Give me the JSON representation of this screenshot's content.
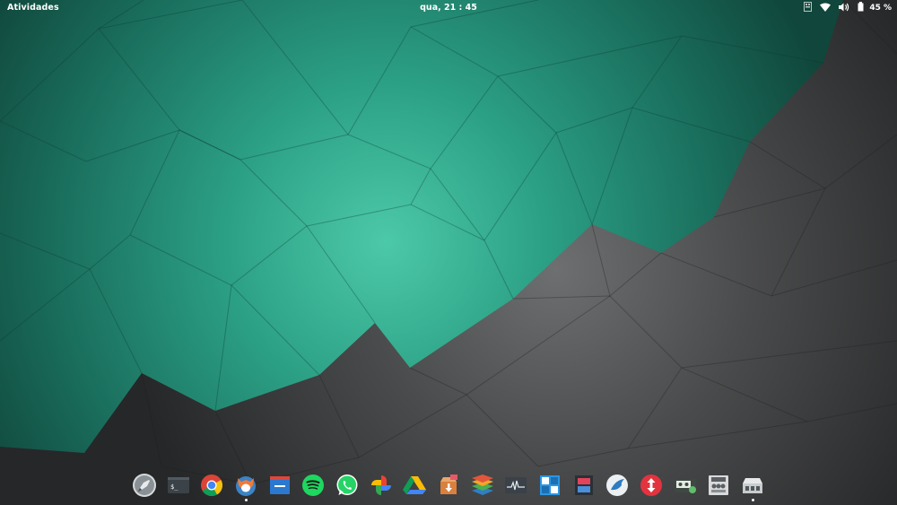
{
  "topbar": {
    "activities_label": "Atividades",
    "clock": "qua, 21 : 45",
    "battery_percent": "45 %",
    "tray_icons": [
      "keyboard-icon",
      "wifi-icon",
      "volume-icon",
      "battery-icon"
    ]
  },
  "dock": {
    "items": [
      {
        "name": "launcher-rocket",
        "running": false
      },
      {
        "name": "terminal",
        "running": false
      },
      {
        "name": "chrome",
        "running": false
      },
      {
        "name": "firefox-developer",
        "running": true
      },
      {
        "name": "file-manager",
        "running": false
      },
      {
        "name": "spotify",
        "running": false
      },
      {
        "name": "whatsapp",
        "running": false
      },
      {
        "name": "google-photos",
        "running": false
      },
      {
        "name": "google-drive",
        "running": false
      },
      {
        "name": "package-installer",
        "running": false
      },
      {
        "name": "layers-stack",
        "running": false
      },
      {
        "name": "system-monitor",
        "running": false
      },
      {
        "name": "tile-grid-app",
        "running": false
      },
      {
        "name": "screen-split-app",
        "running": false
      },
      {
        "name": "bird-client",
        "running": false
      },
      {
        "name": "transmission-updown",
        "running": false
      },
      {
        "name": "tape-player",
        "running": false
      },
      {
        "name": "audio-mixer",
        "running": false
      },
      {
        "name": "sound-device-settings",
        "running": true
      }
    ]
  },
  "colors": {
    "teal_light": "#4ac8a8",
    "teal_dark": "#134c40",
    "gray": "#4c4d4e",
    "gray_dark": "#262728"
  }
}
